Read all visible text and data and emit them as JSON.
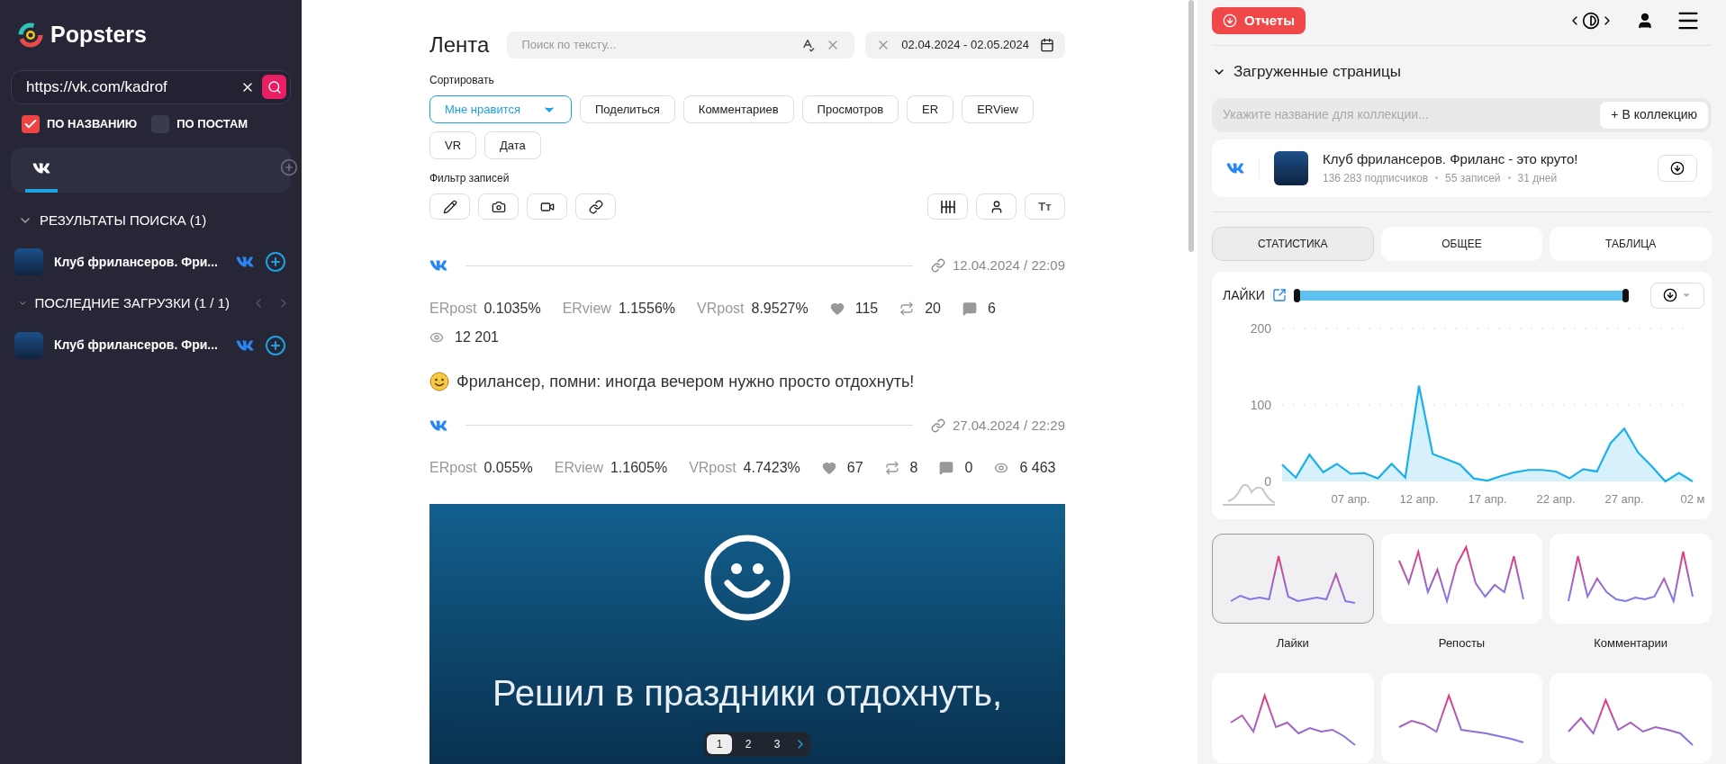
{
  "sidebar": {
    "logo": "Popsters",
    "search": {
      "value": "https://vk.com/kadrof"
    },
    "search_modes": [
      {
        "label": "ПО НАЗВАНИЮ",
        "checked": true
      },
      {
        "label": "ПО ПОСТАМ",
        "checked": false
      }
    ],
    "network_tabs": [
      {
        "kind": "vk",
        "selected": true
      }
    ],
    "sections": [
      {
        "title": "РЕЗУЛЬТАТЫ ПОИСКА (1)",
        "expanded": true,
        "pager": false,
        "items": [
          {
            "kind": "vk",
            "name": "Клуб фрилансеров. Фри..."
          }
        ]
      },
      {
        "title": "ПОСЛЕДНИЕ ЗАГРУЗКИ (1 / 1)",
        "expanded": true,
        "pager": true,
        "items": [
          {
            "kind": "vk",
            "name": "Клуб фрилансеров. Фри..."
          }
        ]
      }
    ]
  },
  "feed": {
    "title": "Лента",
    "search": {
      "placeholder": "Поиск по тексту..."
    },
    "date_range": "02.04.2024 - 02.05.2024",
    "sort_label": "Сортировать",
    "sort_options": [
      {
        "label": "Мне нравится",
        "selected": true
      },
      {
        "label": "Поделиться",
        "selected": false
      },
      {
        "label": "Комментариев",
        "selected": false
      },
      {
        "label": "Просмотров",
        "selected": false
      },
      {
        "label": "ER",
        "selected": false
      },
      {
        "label": "ERView",
        "selected": false
      },
      {
        "label": "VR",
        "selected": false
      },
      {
        "label": "Дата",
        "selected": false
      }
    ],
    "filter_label": "Фильтр записей",
    "font_button": "Тт",
    "posts": [
      {
        "kind": "vk",
        "date": "12.04.2024 / 22:09",
        "metrics": [
          {
            "label": "ERpost",
            "value": "0.1035%"
          },
          {
            "label": "ERview",
            "value": "1.1556%"
          },
          {
            "label": "VRpost",
            "value": "8.9527%"
          }
        ],
        "counters": [
          {
            "kind": "likes",
            "value": "115"
          },
          {
            "kind": "reposts",
            "value": "20"
          },
          {
            "kind": "comments",
            "value": "6"
          },
          {
            "kind": "views",
            "value": "12 201"
          }
        ],
        "text": "Фрилансер, помни: иногда вечером нужно просто отдохнуть!"
      },
      {
        "kind": "vk",
        "date": "27.04.2024 / 22:29",
        "metrics": [
          {
            "label": "ERpost",
            "value": "0.055%"
          },
          {
            "label": "ERview",
            "value": "1.1605%"
          },
          {
            "label": "VRpost",
            "value": "4.7423%"
          }
        ],
        "counters": [
          {
            "kind": "likes",
            "value": "67"
          },
          {
            "kind": "reposts",
            "value": "8"
          },
          {
            "kind": "comments",
            "value": "0"
          },
          {
            "kind": "views",
            "value": "6 463"
          }
        ],
        "image": {
          "caption": "Решил в праздники отдохнуть,"
        }
      }
    ],
    "pagination": [
      {
        "label": "1",
        "selected": true
      },
      {
        "label": "2",
        "selected": false
      },
      {
        "label": "3",
        "selected": false
      }
    ]
  },
  "right": {
    "reports_button": "Отчеты",
    "section": {
      "title": "Загруженные страницы",
      "expanded": true
    },
    "collection": {
      "placeholder": "Укажите название для коллекции...",
      "button": "+ В коллекцию"
    },
    "page": {
      "kind": "vk",
      "name": "Клуб фрилансеров. Фриланс - это круто!",
      "stats": [
        "136 283 подписчиков",
        "55 записей",
        "31 дней"
      ]
    },
    "tabs": [
      {
        "label": "СТАТИСТИКА",
        "selected": true
      },
      {
        "label": "ОБЩЕЕ",
        "selected": false
      },
      {
        "label": "ТАБЛИЦА",
        "selected": false
      }
    ],
    "chart_card": {
      "title": "ЛАЙКИ",
      "chart_data": {
        "type": "area",
        "ylim": [
          0,
          200
        ],
        "yticks": [
          0,
          100,
          200
        ],
        "categories": [
          null,
          null,
          null,
          null,
          null,
          "07 апр.",
          null,
          null,
          null,
          null,
          "12 апр.",
          null,
          null,
          null,
          null,
          "17 апр.",
          null,
          null,
          null,
          null,
          "22 апр.",
          null,
          null,
          null,
          null,
          "27 апр.",
          null,
          null,
          null,
          null,
          "02 м"
        ],
        "series": [
          {
            "color": "#1ab0ea",
            "values": [
              22,
              5,
              35,
              12,
              23,
              10,
              11,
              4,
              23,
              5,
              125,
              36,
              29,
              22,
              4,
              1,
              7,
              12,
              15,
              15,
              13,
              4,
              16,
              13,
              50,
              69,
              38,
              20,
              0,
              11,
              0
            ]
          }
        ]
      }
    },
    "mini_charts": [
      {
        "label": "Лайки",
        "selected": true
      },
      {
        "label": "Репосты",
        "selected": false
      },
      {
        "label": "Комментарии",
        "selected": false
      },
      {
        "selected": false
      },
      {
        "selected": false
      },
      {
        "selected": false
      }
    ]
  }
}
